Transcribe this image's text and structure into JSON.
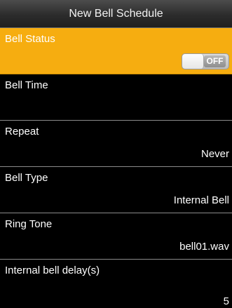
{
  "header": {
    "title": "New Bell Schedule"
  },
  "settings": [
    {
      "label": "Bell Status",
      "toggle": {
        "state": "OFF",
        "on": false
      },
      "selected": true
    },
    {
      "label": "Bell Time",
      "value": ""
    },
    {
      "label": "Repeat",
      "value": "Never"
    },
    {
      "label": "Bell Type",
      "value": "Internal Bell"
    },
    {
      "label": "Ring Tone",
      "value": "bell01.wav"
    },
    {
      "label": "Internal bell delay(s)",
      "value": "5"
    }
  ],
  "colors": {
    "selected_row": "#f6ad10",
    "background": "#000000"
  }
}
